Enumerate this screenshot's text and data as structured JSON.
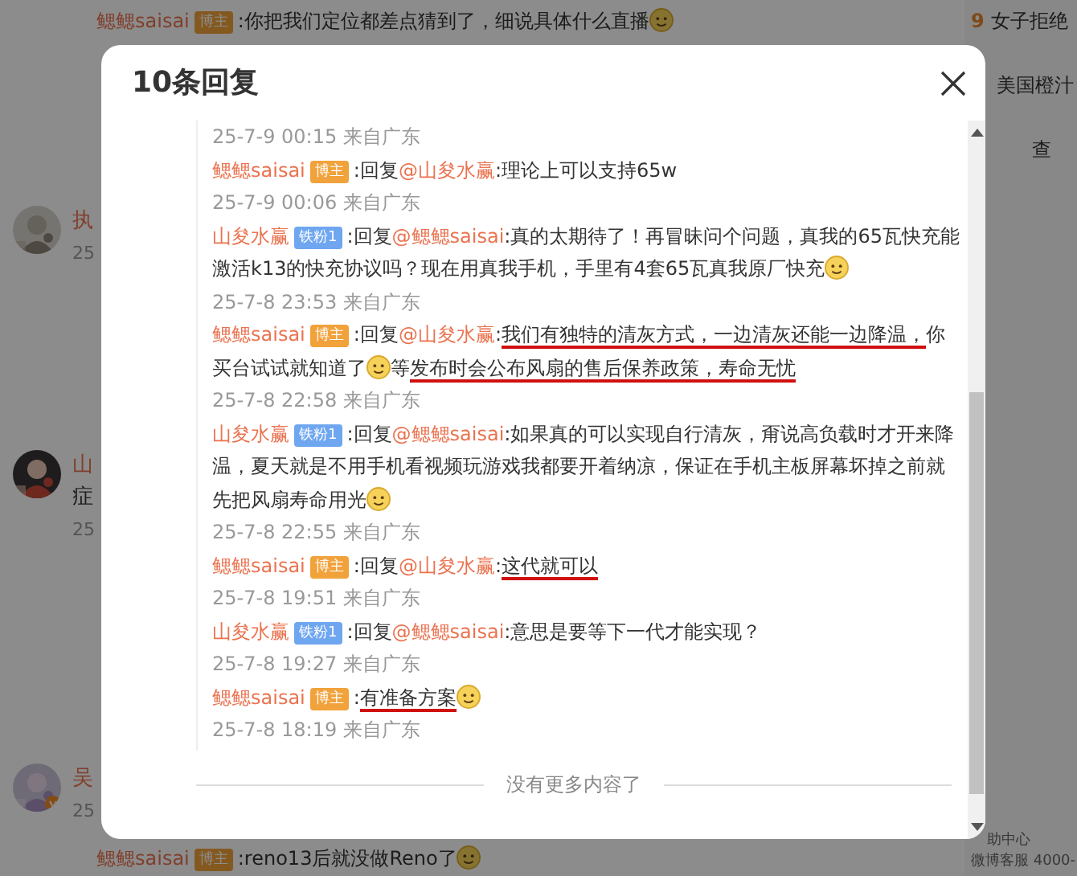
{
  "page": {
    "top_comment": {
      "author": "鳃鳃saisai",
      "badge": {
        "kind": "blogger",
        "label": "博主"
      },
      "parts": [
        {
          "kind": "text",
          "text": ":你把我们定位都差点猜到了，细说具体什么直播"
        },
        {
          "kind": "emoji"
        }
      ]
    },
    "left_fragments": [
      {
        "kind": "avatar",
        "name": "执",
        "time": "25"
      },
      {
        "kind": "avatar",
        "name": "山",
        "text": "症",
        "time": "25"
      },
      {
        "kind": "avatar_verified",
        "name": "吴",
        "time": "25"
      }
    ],
    "sidebar": [
      {
        "rank": "9",
        "text": "女子拒绝"
      },
      {
        "text": "美国橙汁"
      },
      {
        "text": "查"
      }
    ],
    "footer_links": [
      "助中心",
      "微博客服 4000-"
    ],
    "bottom_comment": {
      "author": "鳃鳃saisai",
      "badge": {
        "kind": "blogger",
        "label": "博主"
      },
      "parts": [
        {
          "kind": "text",
          "text": ":reno13后就没做Reno了"
        },
        {
          "kind": "emoji"
        }
      ]
    }
  },
  "dialog": {
    "title": "10条回复",
    "end_note": "没有更多内容了",
    "items": [
      {
        "kind": "time",
        "text": "25-7-9 00:15 来自广东"
      },
      {
        "kind": "comment",
        "author": "鳃鳃saisai",
        "badge": {
          "kind": "blogger",
          "label": "博主"
        },
        "parts": [
          {
            "kind": "text",
            "text": ":回复"
          },
          {
            "kind": "mention",
            "text": "@山夋水赢"
          },
          {
            "kind": "text",
            "text": ":理论上可以支持65w"
          }
        ]
      },
      {
        "kind": "time",
        "text": "25-7-9 00:06 来自广东"
      },
      {
        "kind": "comment",
        "author": "山夋水赢",
        "badge": {
          "kind": "fan",
          "label": "铁粉1"
        },
        "parts": [
          {
            "kind": "text",
            "text": ":回复"
          },
          {
            "kind": "mention",
            "text": "@鳃鳃saisai"
          },
          {
            "kind": "text",
            "text": ":真的太期待了！再冒昧问个问题，真我的65瓦快充能激活k13的快充协议吗？现在用真我手机，手里有4套65瓦真我原厂快充"
          },
          {
            "kind": "emoji"
          }
        ]
      },
      {
        "kind": "time",
        "text": "25-7-8 23:53 来自广东"
      },
      {
        "kind": "comment",
        "author": "鳃鳃saisai",
        "badge": {
          "kind": "blogger",
          "label": "博主"
        },
        "parts": [
          {
            "kind": "text",
            "text": ":回复"
          },
          {
            "kind": "mention",
            "text": "@山夋水赢"
          },
          {
            "kind": "text",
            "text": ":"
          },
          {
            "kind": "text",
            "text": "我们有独特的清灰方式，一边清灰还能一边降温，",
            "underlined": true
          },
          {
            "kind": "text",
            "text": "你买台试试就知道了"
          },
          {
            "kind": "emoji"
          },
          {
            "kind": "text",
            "text": "等"
          },
          {
            "kind": "text",
            "text": "发布时会公布风扇的售后保养政策，寿命无忧",
            "underlined": true
          }
        ]
      },
      {
        "kind": "time",
        "text": "25-7-8 22:58 来自广东"
      },
      {
        "kind": "comment",
        "author": "山夋水赢",
        "badge": {
          "kind": "fan",
          "label": "铁粉1"
        },
        "parts": [
          {
            "kind": "text",
            "text": ":回复"
          },
          {
            "kind": "mention",
            "text": "@鳃鳃saisai"
          },
          {
            "kind": "text",
            "text": ":如果真的可以实现自行清灰，甭说高负载时才开来降温，夏天就是不用手机看视频玩游戏我都要开着纳凉，保证在手机主板屏幕坏掉之前就先把风扇寿命用光"
          },
          {
            "kind": "emoji"
          }
        ]
      },
      {
        "kind": "time",
        "text": "25-7-8 22:55 来自广东"
      },
      {
        "kind": "comment",
        "author": "鳃鳃saisai",
        "badge": {
          "kind": "blogger",
          "label": "博主"
        },
        "parts": [
          {
            "kind": "text",
            "text": ":回复"
          },
          {
            "kind": "mention",
            "text": "@山夋水赢"
          },
          {
            "kind": "text",
            "text": ":"
          },
          {
            "kind": "text",
            "text": "这代就可以",
            "underlined": true
          }
        ]
      },
      {
        "kind": "time",
        "text": "25-7-8 19:51 来自广东"
      },
      {
        "kind": "comment",
        "author": "山夋水赢",
        "badge": {
          "kind": "fan",
          "label": "铁粉1"
        },
        "parts": [
          {
            "kind": "text",
            "text": ":回复"
          },
          {
            "kind": "mention",
            "text": "@鳃鳃saisai"
          },
          {
            "kind": "text",
            "text": ":意思是要等下一代才能实现？"
          }
        ]
      },
      {
        "kind": "time",
        "text": "25-7-8 19:27 来自广东"
      },
      {
        "kind": "comment",
        "author": "鳃鳃saisai",
        "badge": {
          "kind": "blogger",
          "label": "博主"
        },
        "parts": [
          {
            "kind": "text",
            "text": ":"
          },
          {
            "kind": "text",
            "text": "有准备方案",
            "underlined": true
          },
          {
            "kind": "emoji"
          }
        ]
      },
      {
        "kind": "time",
        "text": "25-7-8 18:19 来自广东"
      }
    ]
  }
}
